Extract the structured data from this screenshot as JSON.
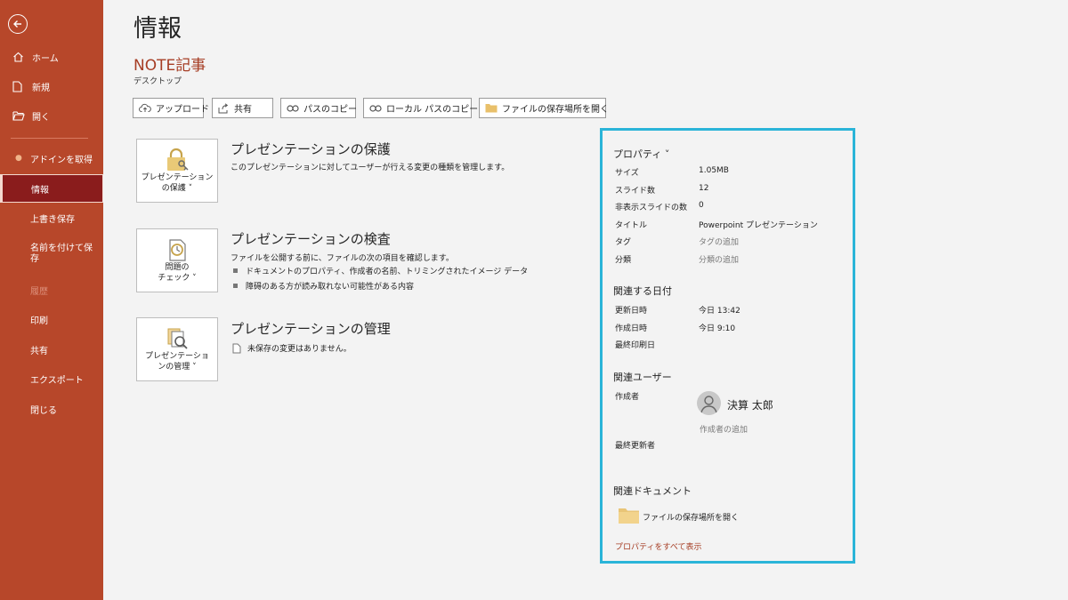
{
  "sidebar": {
    "back_icon": "back-arrow-icon",
    "items": [
      {
        "label": "ホーム",
        "icon": "home-icon"
      },
      {
        "label": "新規",
        "icon": "new-document-icon"
      },
      {
        "label": "開く",
        "icon": "open-folder-icon"
      },
      {
        "label": "アドインを取得"
      },
      {
        "label": "情報",
        "selected": true
      },
      {
        "label": "上書き保存"
      },
      {
        "label": "名前を付けて保存"
      },
      {
        "label": "履歴",
        "disabled": true
      },
      {
        "label": "印刷"
      },
      {
        "label": "共有"
      },
      {
        "label": "エクスポート"
      },
      {
        "label": "閉じる"
      }
    ]
  },
  "main": {
    "title": "情報",
    "doc_name": "NOTE記事",
    "doc_location": "デスクトップ",
    "buttons": {
      "upload": "アップロード",
      "share": "共有",
      "copy_path": "パスのコピー",
      "copy_local_path": "ローカル パスのコピー",
      "open_location": "ファイルの保存場所を開く"
    },
    "sections": {
      "protect": {
        "button_label_1": "プレゼンテーション",
        "button_label_2": "の保護 ˅",
        "title": "プレゼンテーションの保護",
        "desc": "このプレゼンテーションに対してユーザーが行える変更の種類を管理します。"
      },
      "inspect": {
        "button_label_1": "問題の",
        "button_label_2": "チェック ˅",
        "title": "プレゼンテーションの検査",
        "desc": "ファイルを公開する前に、ファイルの次の項目を確認します。",
        "bullets": [
          "ドキュメントのプロパティ、作成者の名前、トリミングされたイメージ データ",
          "障碍のある方が読み取れない可能性がある内容"
        ]
      },
      "manage": {
        "button_label_1": "プレゼンテーショ",
        "button_label_2": "ンの管理 ˅",
        "title": "プレゼンテーションの管理",
        "desc": "未保存の変更はありません。"
      }
    }
  },
  "properties": {
    "header": "プロパティ ˅",
    "rows": [
      {
        "key": "サイズ",
        "value": "1.05MB"
      },
      {
        "key": "スライド数",
        "value": "12"
      },
      {
        "key": "非表示スライドの数",
        "value": "0"
      },
      {
        "key": "タイトル",
        "value": "Powerpoint プレゼンテーション"
      },
      {
        "key": "タグ",
        "value": "タグの追加"
      },
      {
        "key": "分類",
        "value": "分類の追加"
      }
    ],
    "dates_header": "関連する日付",
    "dates": [
      {
        "key": "更新日時",
        "value": "今日 13:42"
      },
      {
        "key": "作成日時",
        "value": "今日 9:10"
      },
      {
        "key": "最終印刷日",
        "value": ""
      }
    ],
    "users_header": "関連ユーザー",
    "author_label": "作成者",
    "author_name": "決算 太郎",
    "add_author": "作成者の追加",
    "last_modified_by": "最終更新者",
    "docs_header": "関連ドキュメント",
    "open_folder": "ファイルの保存場所を開く",
    "show_all": "プロパティをすべて表示"
  },
  "colors": {
    "sidebar": "#b7472a",
    "selected": "#8a1c1c",
    "accent_text": "#a63d24",
    "highlight_border": "#2ab4d8"
  }
}
